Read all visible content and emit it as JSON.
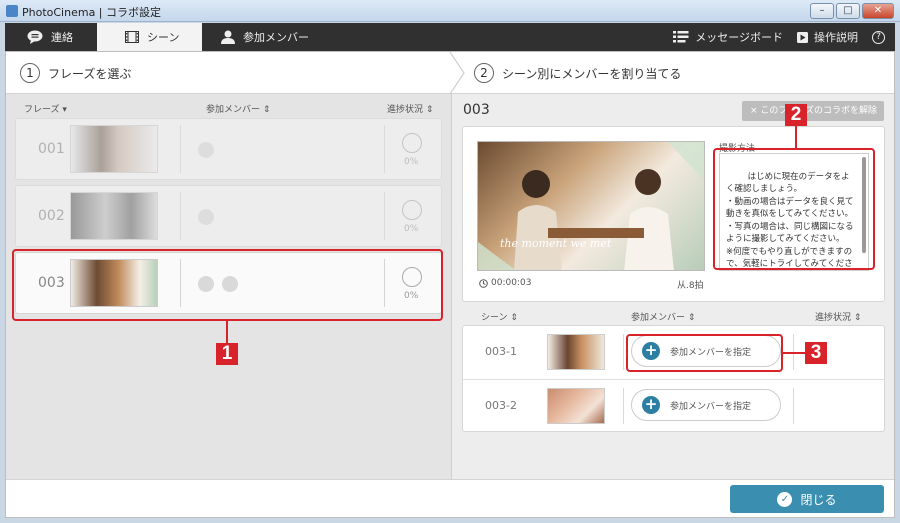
{
  "window": {
    "title": "PhotoCinema | コラボ設定"
  },
  "nav": {
    "tabs": [
      {
        "label": "連絡",
        "icon": "chat-bubble-icon"
      },
      {
        "label": "シーン",
        "icon": "film-icon",
        "active": true
      },
      {
        "label": "参加メンバー",
        "icon": "person-icon"
      }
    ],
    "message_board": "メッセージボード",
    "manual": "操作説明",
    "help": "?"
  },
  "steps": [
    {
      "num": "1",
      "label": "フレーズを選ぶ"
    },
    {
      "num": "2",
      "label": "シーン別にメンバーを割り当てる"
    }
  ],
  "phrases_header": {
    "phrase": "フレーズ",
    "members": "参加メンバー",
    "progress": "進捗状況"
  },
  "phrases": [
    {
      "num": "001",
      "percent": "0%",
      "members": 1,
      "selected": false
    },
    {
      "num": "002",
      "percent": "0%",
      "members": 1,
      "selected": false
    },
    {
      "num": "003",
      "percent": "0%",
      "members": 2,
      "selected": true
    }
  ],
  "detail": {
    "scene_number": "003",
    "unlink_button": "× このフレーズのコラボを解除",
    "video_caption": "the moment we met",
    "timecode": "00:00:03",
    "beats": "从.8拍",
    "how_to_label": "撮影方法",
    "instructions": "はじめに現在のデータをよく確認しましょう。\n・動画の場合はデータを良く見て動きを真似をしてみてください。\n・写真の場合は、同じ構図になるように撮影してみてください。\n※何度でもやり直しができますので、気軽にトライしてみてくださ"
  },
  "shots_header": {
    "scene": "シーン",
    "members": "参加メンバー",
    "progress": "進捗状況"
  },
  "shots": [
    {
      "id": "003-1",
      "assign_label": "参加メンバーを指定"
    },
    {
      "id": "003-2",
      "assign_label": "参加メンバーを指定"
    }
  ],
  "footer": {
    "close_label": "閉じる"
  },
  "annotations": [
    "1",
    "2",
    "3"
  ],
  "colors": {
    "accent": "#3a8fb0",
    "annotation": "#d9232b",
    "navbar": "#303030"
  }
}
